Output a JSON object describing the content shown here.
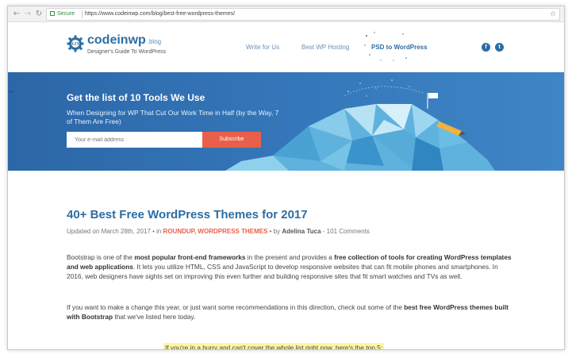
{
  "browser": {
    "secure_label": "Secure",
    "url": "https://www.codeinwp.com/blog/best-free-wordpress-themes/"
  },
  "header": {
    "logo_name": "codeinwp",
    "logo_tld": ".blog",
    "tagline": "Designer's Guide To WordPress",
    "menu": [
      "Write for Us",
      "Best WP Hosting",
      "PSD to WordPress"
    ],
    "social": [
      "f",
      "t"
    ]
  },
  "hero": {
    "title": "Get the list of 10 Tools We Use",
    "subtitle": "When Designing for WP That Cut Our Work Time in Half (by the Way, 7 of Them Are Free)",
    "email_placeholder": "Your e-mail address",
    "subscribe_label": "Subscribe"
  },
  "article": {
    "title": "40+ Best Free WordPress Themes for 2017",
    "meta": {
      "updated": "Updated on March 28th, 2017 • in ",
      "category_1": "ROUNDUP",
      "category_sep": ", ",
      "category_2": "WORDPRESS THEMES",
      "by": " • by ",
      "author": "Adelina Tuca",
      "comments": " - 101 Comments"
    },
    "para1": {
      "t1": "Bootstrap is one of the ",
      "b1": "most popular front-end frameworks",
      "t2": " in the present and provides a ",
      "b2": "free collection of tools for creating WordPress templates and web applications",
      "t3": ". It lets you utilize HTML, CSS and JavaScript to develop responsive websites that can fit mobile phones and smartphones. In 2016, web designers have sights set on improving this even further and building responsive sites that fit smart watches and TVs as well."
    },
    "para2": {
      "t1": "If you want to make a change this year, or just want some recommendations in this direction, check out some of the ",
      "b1": "best free WordPress themes built with Bootstrap",
      "t2": " that we've listed here today."
    },
    "highlight": "If you're in a hurry and can't cover the whole list right now, here's the top 5:"
  },
  "colors": {
    "brand_blue": "#2d6da3",
    "hero_blue": "#3578bb",
    "accent_orange": "#e9604a",
    "highlight_yellow": "#fbf5a6"
  }
}
